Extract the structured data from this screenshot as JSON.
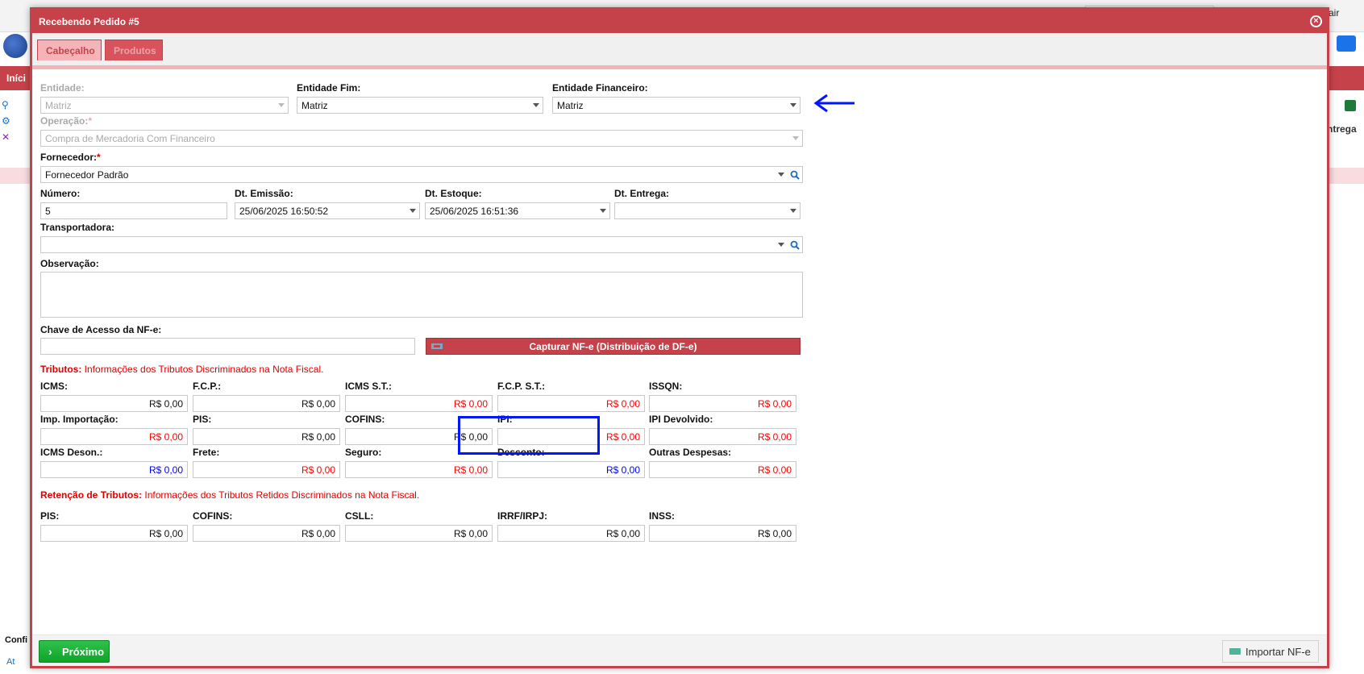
{
  "background": {
    "logout": "Sair",
    "redbar_label": "Iníci",
    "column_label": "ntrega",
    "bottom_label": "Confi",
    "bottom_link": "At"
  },
  "modal": {
    "title": "Recebendo Pedido #5",
    "tabs": [
      "Cabeçalho",
      "Produtos"
    ]
  },
  "fields": {
    "entidade": {
      "label": "Entidade:",
      "value": "Matriz"
    },
    "entidade_fim": {
      "label": "Entidade Fim:",
      "value": "Matriz"
    },
    "entidade_financeiro": {
      "label": "Entidade Financeiro:",
      "value": "Matriz"
    },
    "operacao": {
      "label": "Operação:",
      "value": "Compra de Mercadoria Com Financeiro"
    },
    "fornecedor": {
      "label": "Fornecedor:",
      "value": "Fornecedor Padrão"
    },
    "numero": {
      "label": "Número:",
      "value": "5"
    },
    "dt_emissao": {
      "label": "Dt. Emissão:",
      "value": "25/06/2025 16:50:52"
    },
    "dt_estoque": {
      "label": "Dt. Estoque:",
      "value": "25/06/2025 16:51:36"
    },
    "dt_entrega": {
      "label": "Dt. Entrega:",
      "value": ""
    },
    "transportadora": {
      "label": "Transportadora:",
      "value": ""
    },
    "observacao": {
      "label": "Observação:",
      "value": ""
    },
    "chave": {
      "label": "Chave de Acesso da NF-e:",
      "value": ""
    }
  },
  "capture_button": "Capturar NF-e (Distribuição de DF-e)",
  "tributos": {
    "title": "Tributos:",
    "subtitle": "Informações dos Tributos Discriminados na Nota Fiscal.",
    "items": [
      {
        "label": "ICMS:",
        "value": "R$ 0,00",
        "color": "#111111"
      },
      {
        "label": "F.C.P.:",
        "value": "R$ 0,00",
        "color": "#111111"
      },
      {
        "label": "ICMS S.T.:",
        "value": "R$ 0,00",
        "color": "#ff0000"
      },
      {
        "label": "F.C.P. S.T.:",
        "value": "R$ 0,00",
        "color": "#ff0000"
      },
      {
        "label": "ISSQN:",
        "value": "R$ 0,00",
        "color": "#ff0000"
      },
      {
        "label": "Imp. Importação:",
        "value": "R$ 0,00",
        "color": "#ff0000"
      },
      {
        "label": "PIS:",
        "value": "R$ 0,00",
        "color": "#111111"
      },
      {
        "label": "COFINS:",
        "value": "R$ 0,00",
        "color": "#111111"
      },
      {
        "label": "IPI:",
        "value": "R$ 0,00",
        "color": "#ff0000"
      },
      {
        "label": "IPI Devolvido:",
        "value": "R$ 0,00",
        "color": "#ff0000"
      },
      {
        "label": "ICMS Deson.:",
        "value": "R$ 0,00",
        "color": "#0000ff"
      },
      {
        "label": "Frete:",
        "value": "R$ 0,00",
        "color": "#ff0000"
      },
      {
        "label": "Seguro:",
        "value": "R$ 0,00",
        "color": "#ff0000"
      },
      {
        "label": "Desconto:",
        "value": "R$ 0,00",
        "color": "#0000ff"
      },
      {
        "label": "Outras Despesas:",
        "value": "R$ 0,00",
        "color": "#ff0000"
      }
    ]
  },
  "retencao": {
    "title": "Retenção de Tributos:",
    "subtitle": "Informações dos Tributos Retidos Discriminados na Nota Fiscal.",
    "items": [
      {
        "label": "PIS:",
        "value": "R$ 0,00"
      },
      {
        "label": "COFINS:",
        "value": "R$ 0,00"
      },
      {
        "label": "CSLL:",
        "value": "R$ 0,00"
      },
      {
        "label": "IRRF/IRPJ:",
        "value": "R$ 0,00"
      },
      {
        "label": "INSS:",
        "value": "R$ 0,00"
      }
    ]
  },
  "footer": {
    "next": "Próximo",
    "import": "Importar NF-e"
  },
  "colors": {
    "accent": "#c6424a",
    "highlight": "#0016ff"
  }
}
